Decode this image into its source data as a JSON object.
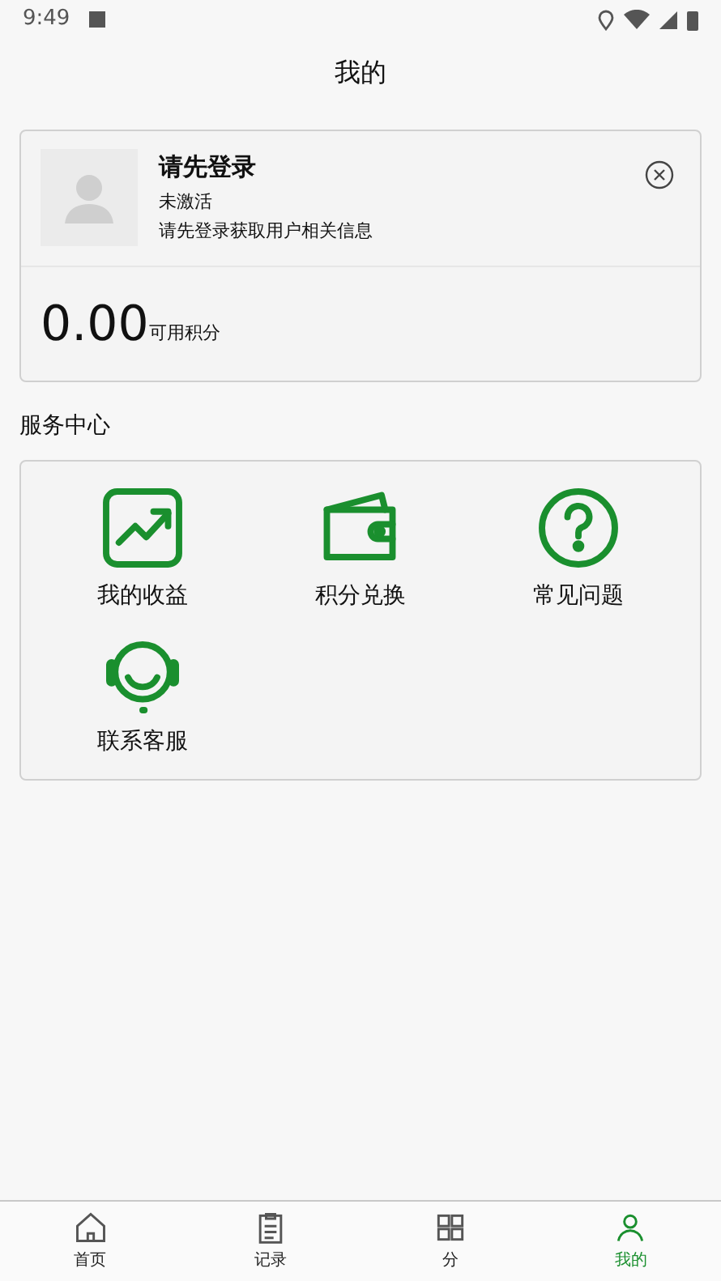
{
  "status_bar": {
    "time": "9:49"
  },
  "header": {
    "title": "我的"
  },
  "profile": {
    "name": "请先登录",
    "status": "未激活",
    "hint": "请先登录获取用户相关信息",
    "points": "0.00",
    "points_label": "可用积分"
  },
  "services": {
    "title": "服务中心",
    "items": [
      {
        "label": "我的收益",
        "kind": "earnings"
      },
      {
        "label": "积分兑换",
        "kind": "wallet"
      },
      {
        "label": "常见问题",
        "kind": "faq"
      },
      {
        "label": "联系客服",
        "kind": "support"
      }
    ]
  },
  "tabs": [
    {
      "label": "首页",
      "kind": "home",
      "selected": false
    },
    {
      "label": "记录",
      "kind": "records",
      "selected": false
    },
    {
      "label": "分",
      "kind": "grid",
      "selected": false
    },
    {
      "label": "我的",
      "kind": "me",
      "selected": true
    }
  ]
}
